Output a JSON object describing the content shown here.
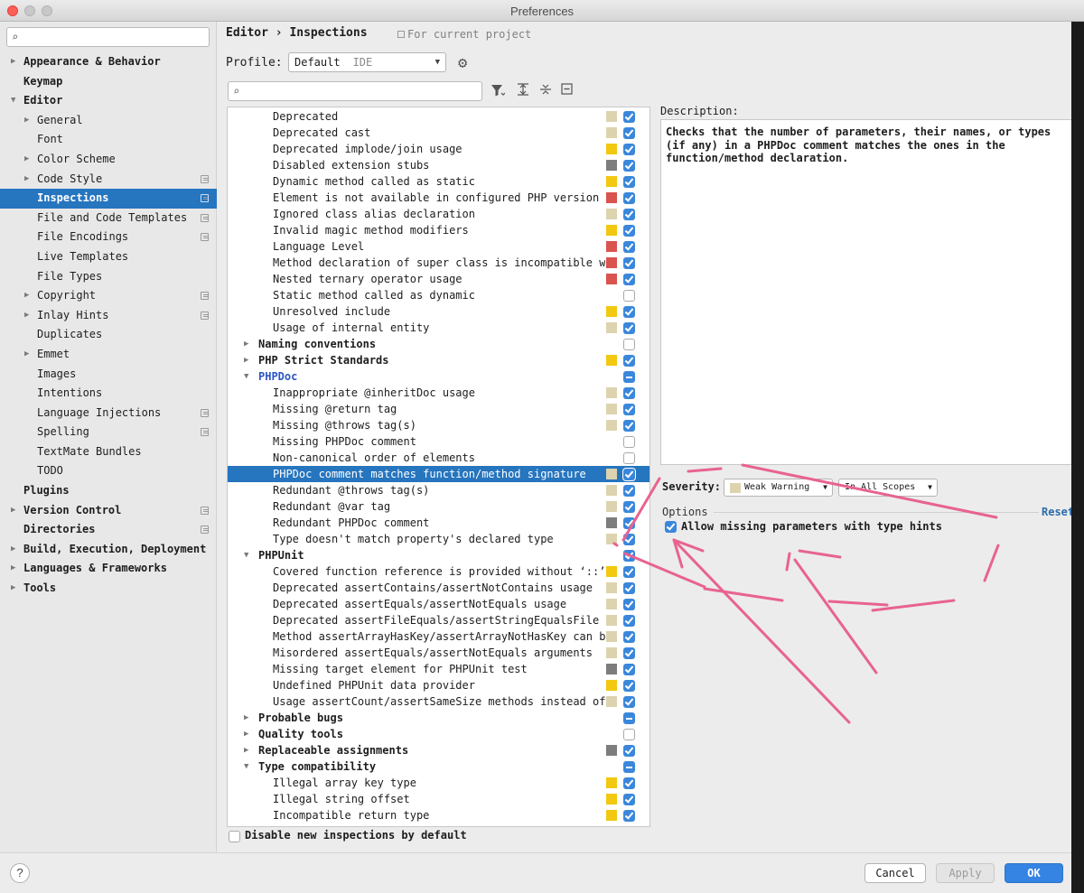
{
  "window": {
    "title": "Preferences"
  },
  "sidebar": {
    "search_placeholder": "",
    "items": [
      {
        "label": "Appearance & Behavior",
        "level": 0,
        "bold": true,
        "arrow": "right"
      },
      {
        "label": "Keymap",
        "level": 0,
        "bold": true
      },
      {
        "label": "Editor",
        "level": 0,
        "bold": true,
        "arrow": "down"
      },
      {
        "label": "General",
        "level": 1,
        "arrow": "right"
      },
      {
        "label": "Font",
        "level": 1
      },
      {
        "label": "Color Scheme",
        "level": 1,
        "arrow": "right"
      },
      {
        "label": "Code Style",
        "level": 1,
        "arrow": "right",
        "copy": true
      },
      {
        "label": "Inspections",
        "level": 1,
        "selected": true,
        "copy": true
      },
      {
        "label": "File and Code Templates",
        "level": 1,
        "copy": true
      },
      {
        "label": "File Encodings",
        "level": 1,
        "copy": true
      },
      {
        "label": "Live Templates",
        "level": 1
      },
      {
        "label": "File Types",
        "level": 1
      },
      {
        "label": "Copyright",
        "level": 1,
        "arrow": "right",
        "copy": true
      },
      {
        "label": "Inlay Hints",
        "level": 1,
        "arrow": "right",
        "copy": true
      },
      {
        "label": "Duplicates",
        "level": 1
      },
      {
        "label": "Emmet",
        "level": 1,
        "arrow": "right"
      },
      {
        "label": "Images",
        "level": 1
      },
      {
        "label": "Intentions",
        "level": 1
      },
      {
        "label": "Language Injections",
        "level": 1,
        "copy": true
      },
      {
        "label": "Spelling",
        "level": 1,
        "copy": true
      },
      {
        "label": "TextMate Bundles",
        "level": 1
      },
      {
        "label": "TODO",
        "level": 1
      },
      {
        "label": "Plugins",
        "level": 0,
        "bold": true
      },
      {
        "label": "Version Control",
        "level": 0,
        "bold": true,
        "arrow": "right",
        "copy": true
      },
      {
        "label": "Directories",
        "level": 0,
        "bold": true,
        "copy": true
      },
      {
        "label": "Build, Execution, Deployment",
        "level": 0,
        "bold": true,
        "arrow": "right"
      },
      {
        "label": "Languages & Frameworks",
        "level": 0,
        "bold": true,
        "arrow": "right"
      },
      {
        "label": "Tools",
        "level": 0,
        "bold": true,
        "arrow": "right"
      }
    ]
  },
  "header": {
    "breadcrumb": "Editor › Inspections",
    "scope_note": "For current project",
    "profile_label": "Profile:",
    "profile_value": "Default",
    "profile_scope": "IDE"
  },
  "inspections": {
    "search_placeholder": "",
    "rows": [
      {
        "label": "Deprecated",
        "type": "child",
        "sev": "#ddd3ae",
        "check": "on"
      },
      {
        "label": "Deprecated cast",
        "type": "child",
        "sev": "#ddd3ae",
        "check": "on"
      },
      {
        "label": "Deprecated implode/join usage",
        "type": "child",
        "sev": "#f2c811",
        "check": "on"
      },
      {
        "label": "Disabled extension stubs",
        "type": "child",
        "sev": "#7d7d7d",
        "check": "on"
      },
      {
        "label": "Dynamic method called as static",
        "type": "child",
        "sev": "#f2c811",
        "check": "on"
      },
      {
        "label": "Element is not available in configured PHP version",
        "type": "child",
        "sev": "#d9534f",
        "check": "on"
      },
      {
        "label": "Ignored class alias declaration",
        "type": "child",
        "sev": "#ddd3ae",
        "check": "on"
      },
      {
        "label": "Invalid magic method modifiers",
        "type": "child",
        "sev": "#f2c811",
        "check": "on"
      },
      {
        "label": "Language Level",
        "type": "child",
        "sev": "#d9534f",
        "check": "on"
      },
      {
        "label": "Method declaration of super class is incompatible wi",
        "type": "child",
        "sev": "#d9534f",
        "check": "on"
      },
      {
        "label": "Nested ternary operator usage",
        "type": "child",
        "sev": "#d9534f",
        "check": "on"
      },
      {
        "label": "Static method called as dynamic",
        "type": "child",
        "sev": "",
        "check": "off"
      },
      {
        "label": "Unresolved include",
        "type": "child",
        "sev": "#f2c811",
        "check": "on"
      },
      {
        "label": "Usage of internal entity",
        "type": "child",
        "sev": "#ddd3ae",
        "check": "on"
      },
      {
        "label": "Naming conventions",
        "type": "group",
        "arrow": "right",
        "sev": "",
        "check": "off"
      },
      {
        "label": "PHP Strict Standards",
        "type": "group",
        "arrow": "right",
        "sev": "#f2c811",
        "check": "on"
      },
      {
        "label": "PHPDoc",
        "type": "group",
        "arrow": "down",
        "sev": "",
        "check": "mixed",
        "highlight": true
      },
      {
        "label": "Inappropriate @inheritDoc usage",
        "type": "child",
        "sev": "#ddd3ae",
        "check": "on"
      },
      {
        "label": "Missing @return tag",
        "type": "child",
        "sev": "#ddd3ae",
        "check": "on"
      },
      {
        "label": "Missing @throws tag(s)",
        "type": "child",
        "sev": "#ddd3ae",
        "check": "on"
      },
      {
        "label": "Missing PHPDoc comment",
        "type": "child",
        "sev": "",
        "check": "off"
      },
      {
        "label": "Non-canonical order of elements",
        "type": "child",
        "sev": "",
        "check": "off"
      },
      {
        "label": "PHPDoc comment matches function/method signature",
        "type": "child",
        "sev": "#ddd3ae",
        "check": "on",
        "selected": true
      },
      {
        "label": "Redundant @throws tag(s)",
        "type": "child",
        "sev": "#ddd3ae",
        "check": "on"
      },
      {
        "label": "Redundant @var tag",
        "type": "child",
        "sev": "#ddd3ae",
        "check": "on"
      },
      {
        "label": "Redundant PHPDoc comment",
        "type": "child",
        "sev": "#7d7d7d",
        "check": "on"
      },
      {
        "label": "Type doesn't match property's declared type",
        "type": "child",
        "sev": "#ddd3ae",
        "check": "on"
      },
      {
        "label": "PHPUnit",
        "type": "group",
        "arrow": "down",
        "sev": "",
        "check": "on"
      },
      {
        "label": "Covered function reference is provided without ‘::’",
        "type": "child",
        "sev": "#f2c811",
        "check": "on"
      },
      {
        "label": "Deprecated assertContains/assertNotContains usage",
        "type": "child",
        "sev": "#ddd3ae",
        "check": "on"
      },
      {
        "label": "Deprecated assertEquals/assertNotEquals usage",
        "type": "child",
        "sev": "#ddd3ae",
        "check": "on"
      },
      {
        "label": "Deprecated assertFileEquals/assertStringEqualsFile u",
        "type": "child",
        "sev": "#ddd3ae",
        "check": "on"
      },
      {
        "label": "Method assertArrayHasKey/assertArrayNotHasKey can be",
        "type": "child",
        "sev": "#ddd3ae",
        "check": "on"
      },
      {
        "label": "Misordered assertEquals/assertNotEquals arguments",
        "type": "child",
        "sev": "#ddd3ae",
        "check": "on"
      },
      {
        "label": "Missing target element for PHPUnit test",
        "type": "child",
        "sev": "#7d7d7d",
        "check": "on"
      },
      {
        "label": "Undefined PHPUnit data provider",
        "type": "child",
        "sev": "#f2c811",
        "check": "on"
      },
      {
        "label": "Usage assertCount/assertSameSize methods instead of",
        "type": "child",
        "sev": "#ddd3ae",
        "check": "on"
      },
      {
        "label": "Probable bugs",
        "type": "group",
        "arrow": "right",
        "sev": "",
        "check": "mixed"
      },
      {
        "label": "Quality tools",
        "type": "group",
        "arrow": "right",
        "sev": "",
        "check": "off"
      },
      {
        "label": "Replaceable assignments",
        "type": "group",
        "arrow": "right",
        "sev": "#7d7d7d",
        "check": "on"
      },
      {
        "label": "Type compatibility",
        "type": "group",
        "arrow": "down",
        "sev": "",
        "check": "mixed"
      },
      {
        "label": "Illegal array key type",
        "type": "child",
        "sev": "#f2c811",
        "check": "on"
      },
      {
        "label": "Illegal string offset",
        "type": "child",
        "sev": "#f2c811",
        "check": "on"
      },
      {
        "label": "Incompatible return type",
        "type": "child",
        "sev": "#f2c811",
        "check": "on"
      }
    ],
    "disable_new_label": "Disable new inspections by default"
  },
  "details": {
    "description_label": "Description:",
    "description": "Checks that the number of parameters, their names, or types (if any) in a PHPDoc comment matches the ones in the function/method declaration.",
    "severity_label": "Severity:",
    "severity_value": "Weak Warning",
    "severity_color": "#ddd3ae",
    "scope_value": "In All Scopes",
    "options_label": "Options",
    "reset_label": "Reset",
    "option_allow_missing": "Allow missing parameters with type hints"
  },
  "footer": {
    "help_label": "?",
    "cancel_label": "Cancel",
    "apply_label": "Apply",
    "ok_label": "OK"
  },
  "colors": {
    "selection": "#2675bf",
    "checkbox": "#3a87db",
    "annotation": "#e8638f"
  }
}
